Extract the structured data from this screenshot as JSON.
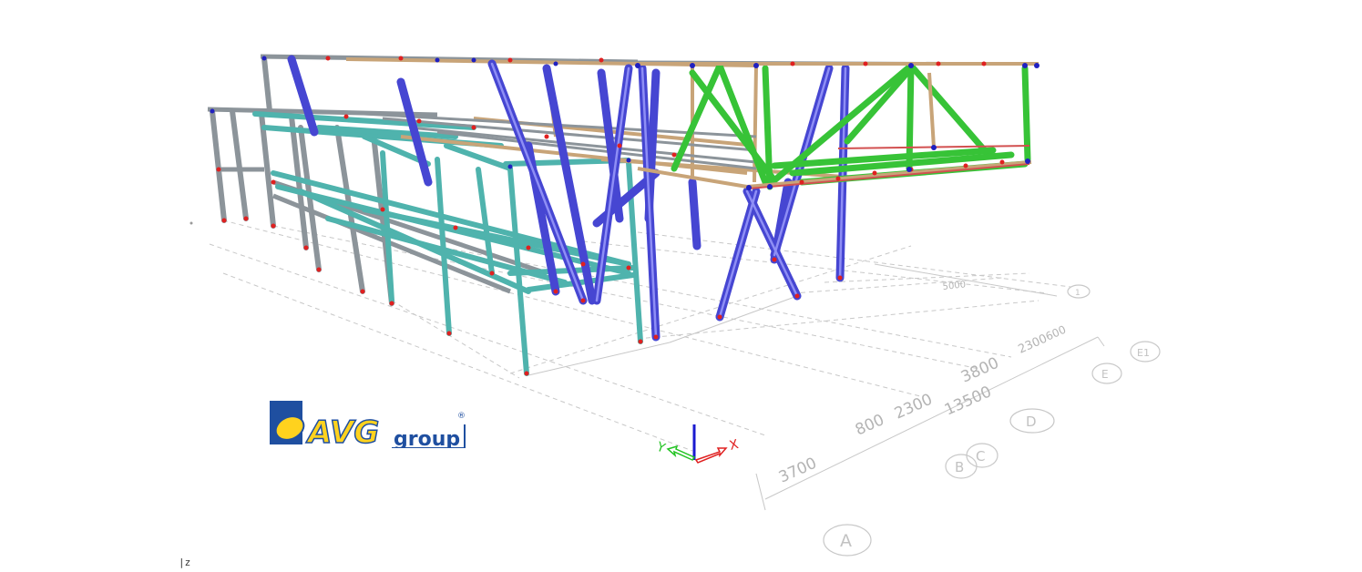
{
  "logo": {
    "text_avg": "AVG",
    "text_group": "group",
    "registered": "®"
  },
  "dimensions": {
    "d3700": "3700",
    "d800": "800",
    "d2300": "2300",
    "d13500": "13500",
    "d3800": "3800",
    "d2300b": "2300",
    "d600": "600",
    "d1": "5000"
  },
  "grid_axes": {
    "a": "A",
    "b": "B",
    "c": "C",
    "d": "D",
    "e": "E",
    "f": "E1",
    "g": "1"
  },
  "triad": {
    "x": "X",
    "y": "Y",
    "z": "Z"
  },
  "status": {
    "z_marker": "|z"
  },
  "colors": {
    "steel_gray": "#8c949a",
    "steel_teal": "#4fb3ad",
    "brace_blue": "#4646d2",
    "truss_green": "#37c337",
    "beam_tan": "#c8a478",
    "node_red": "#e02020",
    "node_blue": "#2020c0"
  }
}
